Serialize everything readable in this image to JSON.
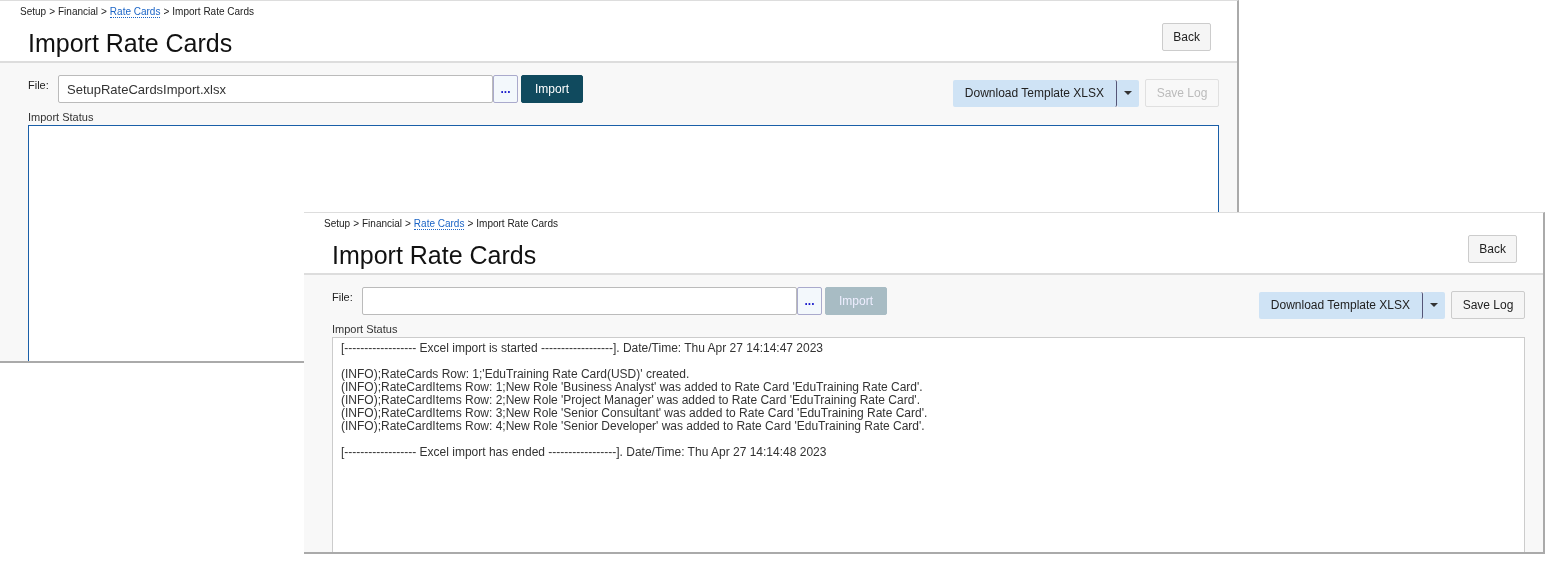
{
  "windows": [
    {
      "breadcrumb": [
        {
          "text": "Setup",
          "link": false
        },
        {
          "text": "Financial",
          "link": false
        },
        {
          "text": "Rate Cards",
          "link": true
        },
        {
          "text": "Import Rate Cards",
          "link": false
        }
      ],
      "separator": ">",
      "title": "Import Rate Cards",
      "back_button": "Back",
      "file_label": "File:",
      "file_value": "SetupRateCardsImport.xlsx",
      "browse_button": "...",
      "import_button": {
        "label": "Import",
        "disabled": false
      },
      "download_button": "Download Template XLSX",
      "save_log_button": {
        "label": "Save Log",
        "disabled": true
      },
      "status_label": "Import Status",
      "status_focused": true
    },
    {
      "breadcrumb": [
        {
          "text": "Setup",
          "link": false
        },
        {
          "text": "Financial",
          "link": false
        },
        {
          "text": "Rate Cards",
          "link": true
        },
        {
          "text": "Import Rate Cards",
          "link": false
        }
      ],
      "separator": ">",
      "title": "Import Rate Cards",
      "back_button": "Back",
      "file_label": "File:",
      "browse_button": "...",
      "import_button": {
        "label": "Import",
        "disabled": true
      },
      "download_button": "Download Template XLSX",
      "save_log_button": {
        "label": "Save Log",
        "disabled": false
      },
      "status_label": "Import Status",
      "status_focused": false,
      "log": [
        [
          "[------------------ Excel import is started ------------------]. Date/Time: Thu Apr 27 14:14:47 2023"
        ],
        [
          "(INFO);RateCards Row: 1;'EduTraining Rate Card(USD)' created.",
          "(INFO);RateCardItems Row: 1;New Role 'Business Analyst' was added to Rate Card 'EduTraining Rate Card'.",
          "(INFO);RateCardItems Row: 2;New Role 'Project Manager' was added to Rate Card 'EduTraining Rate Card'.",
          "(INFO);RateCardItems Row: 3;New Role 'Senior Consultant' was added to Rate Card 'EduTraining Rate Card'.",
          "(INFO);RateCardItems Row: 4;New Role 'Senior Developer' was added to Rate Card 'EduTraining Rate Card'."
        ],
        [
          "[------------------ Excel import has ended -----------------]. Date/Time: Thu Apr 27 14:14:48 2023"
        ]
      ]
    }
  ]
}
